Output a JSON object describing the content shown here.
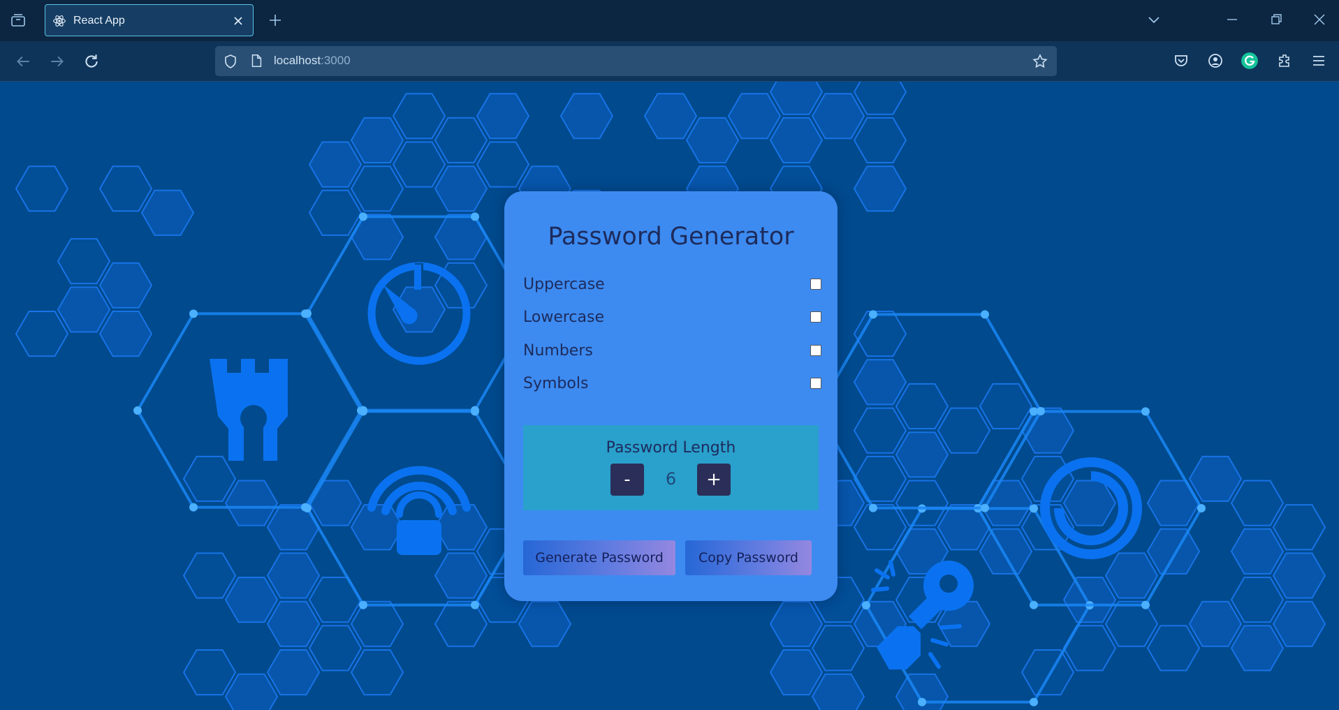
{
  "browser": {
    "tab_title": "React App",
    "url_host": "localhost",
    "url_port": ":3000"
  },
  "app": {
    "title": "Password Generator",
    "options": [
      {
        "label": "Uppercase",
        "checked": false
      },
      {
        "label": "Lowercase",
        "checked": false
      },
      {
        "label": "Numbers",
        "checked": false
      },
      {
        "label": "Symbols",
        "checked": false
      }
    ],
    "length": {
      "label": "Password Length",
      "value": "6",
      "decrement_label": "-",
      "increment_label": "+"
    },
    "buttons": {
      "generate": "Generate Password",
      "copy": "Copy Password"
    }
  },
  "colors": {
    "page_bg": "#004a8d",
    "card_bg": "#3d8bf1",
    "length_box_bg": "#2aa0cc",
    "stepper_bg": "#2a2e58",
    "text_dark": "#1d2b5c",
    "tab_border": "#5ec3e8"
  },
  "icons": [
    "tab-overview-icon",
    "react-icon",
    "close-icon",
    "plus-icon",
    "chevron-down-icon",
    "minimize-icon",
    "restore-icon",
    "window-close-icon",
    "back-arrow-icon",
    "forward-arrow-icon",
    "reload-icon",
    "shield-icon",
    "page-icon",
    "star-icon",
    "pocket-icon",
    "account-icon",
    "grammarly-icon",
    "extensions-icon",
    "menu-icon",
    "fortress-icon",
    "timer-icon",
    "wifi-lock-icon",
    "broken-key-icon",
    "ring-icon"
  ]
}
